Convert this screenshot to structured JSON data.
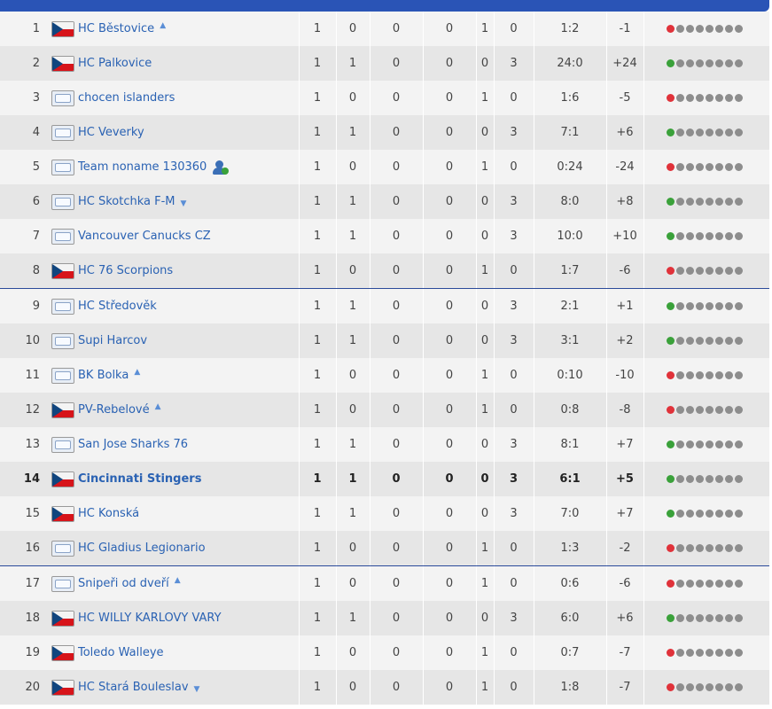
{
  "colors": {
    "accent": "#2a54b6",
    "team_link": "#2a62b3",
    "win": "#3aa13a",
    "loss": "#e0323a",
    "neutral": "#8d8d8d"
  },
  "rows": [
    {
      "rank": "1",
      "team": "HC Běstovice",
      "flag": "cz",
      "mark": "up",
      "gp": "1",
      "w": "0",
      "otw": "0",
      "otl": "0",
      "l": "1",
      "pts": "0",
      "score": "1:2",
      "diff": "-1",
      "form": "l"
    },
    {
      "rank": "2",
      "team": "HC Palkovice",
      "flag": "cz",
      "mark": "",
      "gp": "1",
      "w": "1",
      "otw": "0",
      "otl": "0",
      "l": "0",
      "pts": "3",
      "score": "24:0",
      "diff": "+24",
      "form": "w"
    },
    {
      "rank": "3",
      "team": "chocen islanders",
      "flag": "gen",
      "mark": "",
      "gp": "1",
      "w": "0",
      "otw": "0",
      "otl": "0",
      "l": "1",
      "pts": "0",
      "score": "1:6",
      "diff": "-5",
      "form": "l"
    },
    {
      "rank": "4",
      "team": "HC Veverky",
      "flag": "gen",
      "mark": "",
      "gp": "1",
      "w": "1",
      "otw": "0",
      "otl": "0",
      "l": "0",
      "pts": "3",
      "score": "7:1",
      "diff": "+6",
      "form": "w"
    },
    {
      "rank": "5",
      "team": "Team noname 130360",
      "flag": "gen",
      "mark": "user",
      "gp": "1",
      "w": "0",
      "otw": "0",
      "otl": "0",
      "l": "1",
      "pts": "0",
      "score": "0:24",
      "diff": "-24",
      "form": "l"
    },
    {
      "rank": "6",
      "team": "HC Skotchka F-M",
      "flag": "gen",
      "mark": "down",
      "gp": "1",
      "w": "1",
      "otw": "0",
      "otl": "0",
      "l": "0",
      "pts": "3",
      "score": "8:0",
      "diff": "+8",
      "form": "w"
    },
    {
      "rank": "7",
      "team": "Vancouver Canucks CZ",
      "flag": "gen",
      "mark": "",
      "gp": "1",
      "w": "1",
      "otw": "0",
      "otl": "0",
      "l": "0",
      "pts": "3",
      "score": "10:0",
      "diff": "+10",
      "form": "w"
    },
    {
      "rank": "8",
      "team": "HC 76 Scorpions",
      "flag": "cz",
      "mark": "",
      "gp": "1",
      "w": "0",
      "otw": "0",
      "otl": "0",
      "l": "1",
      "pts": "0",
      "score": "1:7",
      "diff": "-6",
      "form": "l"
    },
    {
      "rank": "9",
      "team": "HC Středověk",
      "flag": "gen",
      "mark": "",
      "gp": "1",
      "w": "1",
      "otw": "0",
      "otl": "0",
      "l": "0",
      "pts": "3",
      "score": "2:1",
      "diff": "+1",
      "form": "w",
      "sep": true
    },
    {
      "rank": "10",
      "team": "Supi Harcov",
      "flag": "gen",
      "mark": "",
      "gp": "1",
      "w": "1",
      "otw": "0",
      "otl": "0",
      "l": "0",
      "pts": "3",
      "score": "3:1",
      "diff": "+2",
      "form": "w"
    },
    {
      "rank": "11",
      "team": "BK Bolka",
      "flag": "gen",
      "mark": "up",
      "gp": "1",
      "w": "0",
      "otw": "0",
      "otl": "0",
      "l": "1",
      "pts": "0",
      "score": "0:10",
      "diff": "-10",
      "form": "l"
    },
    {
      "rank": "12",
      "team": "PV-Rebelové",
      "flag": "cz",
      "mark": "up",
      "gp": "1",
      "w": "0",
      "otw": "0",
      "otl": "0",
      "l": "1",
      "pts": "0",
      "score": "0:8",
      "diff": "-8",
      "form": "l"
    },
    {
      "rank": "13",
      "team": "San Jose Sharks 76",
      "flag": "gen",
      "mark": "",
      "gp": "1",
      "w": "1",
      "otw": "0",
      "otl": "0",
      "l": "0",
      "pts": "3",
      "score": "8:1",
      "diff": "+7",
      "form": "w"
    },
    {
      "rank": "14",
      "team": "Cincinnati Stingers",
      "flag": "cz",
      "mark": "",
      "gp": "1",
      "w": "1",
      "otw": "0",
      "otl": "0",
      "l": "0",
      "pts": "3",
      "score": "6:1",
      "diff": "+5",
      "form": "w",
      "bold": true
    },
    {
      "rank": "15",
      "team": "HC Konská",
      "flag": "cz",
      "mark": "",
      "gp": "1",
      "w": "1",
      "otw": "0",
      "otl": "0",
      "l": "0",
      "pts": "3",
      "score": "7:0",
      "diff": "+7",
      "form": "w"
    },
    {
      "rank": "16",
      "team": "HC Gladius Legionario",
      "flag": "gen",
      "mark": "",
      "gp": "1",
      "w": "0",
      "otw": "0",
      "otl": "0",
      "l": "1",
      "pts": "0",
      "score": "1:3",
      "diff": "-2",
      "form": "l"
    },
    {
      "rank": "17",
      "team": "Snipeři od dveří",
      "flag": "gen",
      "mark": "up",
      "gp": "1",
      "w": "0",
      "otw": "0",
      "otl": "0",
      "l": "1",
      "pts": "0",
      "score": "0:6",
      "diff": "-6",
      "form": "l",
      "sep": true
    },
    {
      "rank": "18",
      "team": "HC WILLY KARLOVY VARY",
      "flag": "cz",
      "mark": "",
      "gp": "1",
      "w": "1",
      "otw": "0",
      "otl": "0",
      "l": "0",
      "pts": "3",
      "score": "6:0",
      "diff": "+6",
      "form": "w"
    },
    {
      "rank": "19",
      "team": "Toledo Walleye",
      "flag": "cz",
      "mark": "",
      "gp": "1",
      "w": "0",
      "otw": "0",
      "otl": "0",
      "l": "1",
      "pts": "0",
      "score": "0:7",
      "diff": "-7",
      "form": "l"
    },
    {
      "rank": "20",
      "team": "HC Stará Bouleslav",
      "flag": "cz",
      "mark": "down",
      "gp": "1",
      "w": "0",
      "otw": "0",
      "otl": "0",
      "l": "1",
      "pts": "0",
      "score": "1:8",
      "diff": "-7",
      "form": "l"
    }
  ]
}
